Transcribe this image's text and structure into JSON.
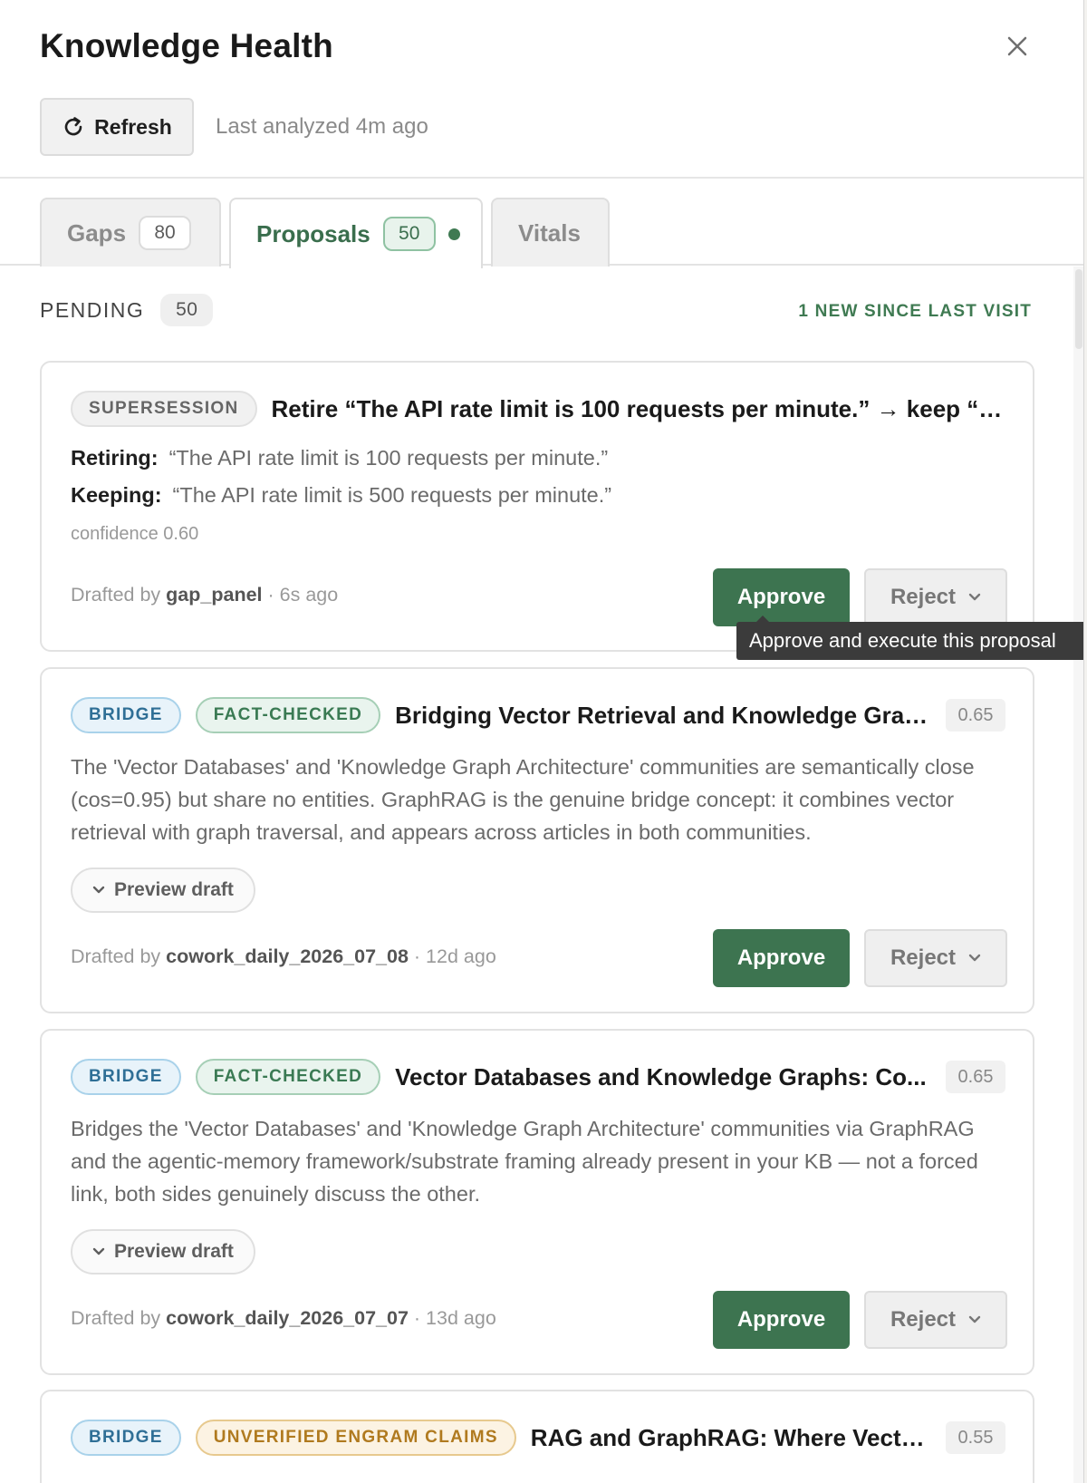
{
  "header": {
    "title": "Knowledge Health",
    "refresh_label": "Refresh",
    "last_analyzed": "Last analyzed 4m ago"
  },
  "tabs": [
    {
      "label": "Gaps",
      "count": "80"
    },
    {
      "label": "Proposals",
      "count": "50",
      "has_new": true
    },
    {
      "label": "Vitals"
    }
  ],
  "pending": {
    "label": "PENDING",
    "count": "50",
    "new_since": "1 NEW SINCE LAST VISIT"
  },
  "tooltip": "Approve and execute this proposal",
  "cards": [
    {
      "tags": [
        "SUPERSESSION"
      ],
      "title": "Retire “The API rate limit is 100 requests per minute.” → keep “T...",
      "retiring_label": "Retiring:",
      "retiring": "“The API rate limit is 100 requests per minute.”",
      "keeping_label": "Keeping:",
      "keeping": "“The API rate limit is 500 requests per minute.”",
      "confidence": "confidence 0.60",
      "drafted_prefix": "Drafted by",
      "drafted_by": "gap_panel",
      "drafted_time": "· 6s ago",
      "approve": "Approve",
      "reject": "Reject"
    },
    {
      "tags": [
        "BRIDGE",
        "FACT-CHECKED"
      ],
      "title": "Bridging Vector Retrieval and Knowledge Grap...",
      "score": "0.65",
      "description": "The 'Vector Databases' and 'Knowledge Graph Architecture' communities are semantically close (cos=0.95) but share no entities. GraphRAG is the genuine bridge concept: it combines vector retrieval with graph traversal, and appears across articles in both communities.",
      "preview": "Preview draft",
      "drafted_prefix": "Drafted by",
      "drafted_by": "cowork_daily_2026_07_08",
      "drafted_time": "· 12d ago",
      "approve": "Approve",
      "reject": "Reject"
    },
    {
      "tags": [
        "BRIDGE",
        "FACT-CHECKED"
      ],
      "title": "Vector Databases and Knowledge Graphs: Co...",
      "score": "0.65",
      "description": "Bridges the 'Vector Databases' and 'Knowledge Graph Architecture' communities via GraphRAG and the agentic-memory framework/substrate framing already present in your KB — not a forced link, both sides genuinely discuss the other.",
      "preview": "Preview draft",
      "drafted_prefix": "Drafted by",
      "drafted_by": "cowork_daily_2026_07_07",
      "drafted_time": "· 13d ago",
      "approve": "Approve",
      "reject": "Reject"
    },
    {
      "tags": [
        "BRIDGE",
        "UNVERIFIED ENGRAM CLAIMS"
      ],
      "title": "RAG and GraphRAG: Where Vector ...",
      "score": "0.55"
    }
  ],
  "colors": {
    "accent_green": "#3d7450",
    "tag_blue": "#2f6f96",
    "tag_green": "#3a7a53",
    "tag_amber": "#b07a1f"
  },
  "icons": {
    "close": "close-icon",
    "refresh": "refresh-icon",
    "reject_menu": "chevron-down-icon",
    "preview": "chevron-down-icon"
  }
}
